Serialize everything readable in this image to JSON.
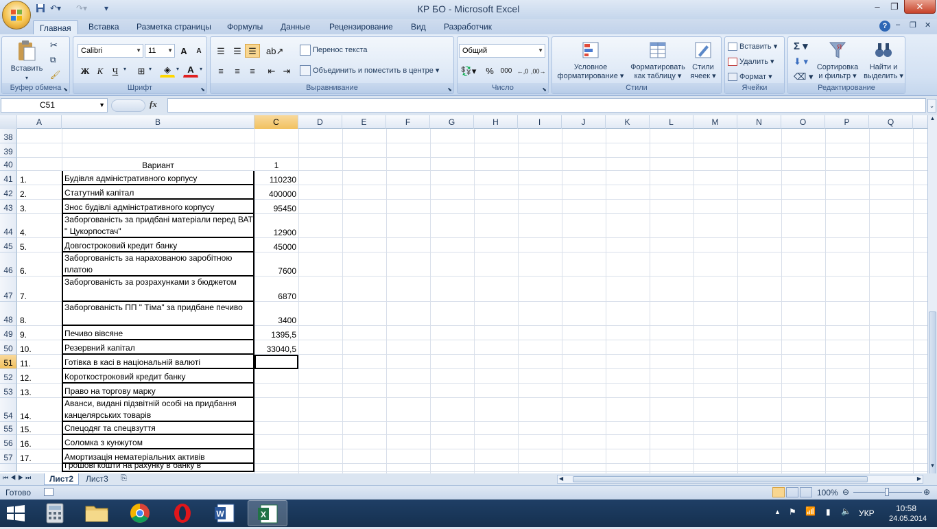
{
  "window": {
    "title": "КР БО - Microsoft Excel"
  },
  "ribbon_tabs": [
    "Главная",
    "Вставка",
    "Разметка страницы",
    "Формулы",
    "Данные",
    "Рецензирование",
    "Вид",
    "Разработчик"
  ],
  "clipboard": {
    "paste": "Вставить",
    "group": "Буфер обмена"
  },
  "font": {
    "name": "Calibri",
    "size": "11",
    "bold": "Ж",
    "italic": "К",
    "underline": "Ч",
    "group": "Шрифт",
    "grow": "A",
    "shrink": "A"
  },
  "alignment": {
    "wrap": "Перенос текста",
    "merge": "Объединить и поместить в центре",
    "group": "Выравнивание"
  },
  "number": {
    "format": "Общий",
    "percent": "%",
    "thousands": "000",
    "group": "Число"
  },
  "styles": {
    "conditional_1": "Условное",
    "conditional_2": "форматирование",
    "table_1": "Форматировать",
    "table_2": "как таблицу",
    "cell_1": "Стили",
    "cell_2": "ячеек",
    "group": "Стили"
  },
  "cells": {
    "insert": "Вставить",
    "delete": "Удалить",
    "format": "Формат",
    "group": "Ячейки"
  },
  "editing": {
    "sort_1": "Сортировка",
    "sort_2": "и фильтр",
    "find_1": "Найти и",
    "find_2": "выделить",
    "group": "Редактирование"
  },
  "formula_bar": {
    "name_box": "C51",
    "fx": "fx",
    "value": ""
  },
  "columns": [
    "A",
    "B",
    "C",
    "D",
    "E",
    "F",
    "G",
    "H",
    "I",
    "J",
    "K",
    "L",
    "M",
    "N",
    "O",
    "P",
    "Q"
  ],
  "rows": [
    {
      "num": "38",
      "a": "",
      "b": "",
      "c": ""
    },
    {
      "num": "39",
      "a": "",
      "b": "",
      "c": ""
    },
    {
      "num": "40",
      "a": "",
      "b": "Вариант",
      "c": "1"
    },
    {
      "num": "41",
      "a": "1.",
      "b": "Будівля адміністративного корпусу",
      "c": "110230"
    },
    {
      "num": "42",
      "a": "2.",
      "b": "Статутний капітал",
      "c": "400000"
    },
    {
      "num": "43",
      "a": "3.",
      "b": "Знос будівлі адміністративного корпусу",
      "c": "95450"
    },
    {
      "num": "44",
      "a": "4.",
      "b": "Заборгованість за придбані матеріали перед ВАТ \" Цукорпостач\"",
      "c": "12900"
    },
    {
      "num": "45",
      "a": "5.",
      "b": "Довгостроковий кредит банку",
      "c": "45000"
    },
    {
      "num": "46",
      "a": "6.",
      "b": "Заборгованість за нарахованою заробітною платою",
      "c": "7600"
    },
    {
      "num": "47",
      "a": "7.",
      "b": "Заборгованість за розрахунками з бюджетом",
      "c": "6870"
    },
    {
      "num": "48",
      "a": "8.",
      "b": "Заборгованість ПП \" Тіма\" за придбане печиво",
      "c": "3400"
    },
    {
      "num": "49",
      "a": "9.",
      "b": "Печиво вівсяне",
      "c": "1395,5"
    },
    {
      "num": "50",
      "a": "10.",
      "b": "Резервний капітал",
      "c": "33040,5"
    },
    {
      "num": "51",
      "a": "11.",
      "b": "Готівка в касі в національній валюті",
      "c": ""
    },
    {
      "num": "52",
      "a": "12.",
      "b": "Короткостроковий кредит банку",
      "c": ""
    },
    {
      "num": "53",
      "a": "13.",
      "b": "Право на торгову марку",
      "c": ""
    },
    {
      "num": "54",
      "a": "14.",
      "b": "Аванси,  видані підзвітній особі на придбання канцелярських товарів",
      "c": ""
    },
    {
      "num": "55",
      "a": "15.",
      "b": "Спецодяг та спецвзуття",
      "c": ""
    },
    {
      "num": "56",
      "a": "16.",
      "b": "Соломка з кунжутом",
      "c": ""
    },
    {
      "num": "57",
      "a": "17.",
      "b": "Амортизація нематеріальних активів",
      "c": ""
    },
    {
      "num": "",
      "a": "",
      "b": "Грошові кошти на рахунку в банку в",
      "c": ""
    }
  ],
  "sheets": [
    "Лист2",
    "Лист3"
  ],
  "status": {
    "ready": "Готово",
    "zoom": "100%"
  },
  "taskbar": {
    "lang": "УКР",
    "time": "10:58",
    "date": "24.05.2014"
  }
}
